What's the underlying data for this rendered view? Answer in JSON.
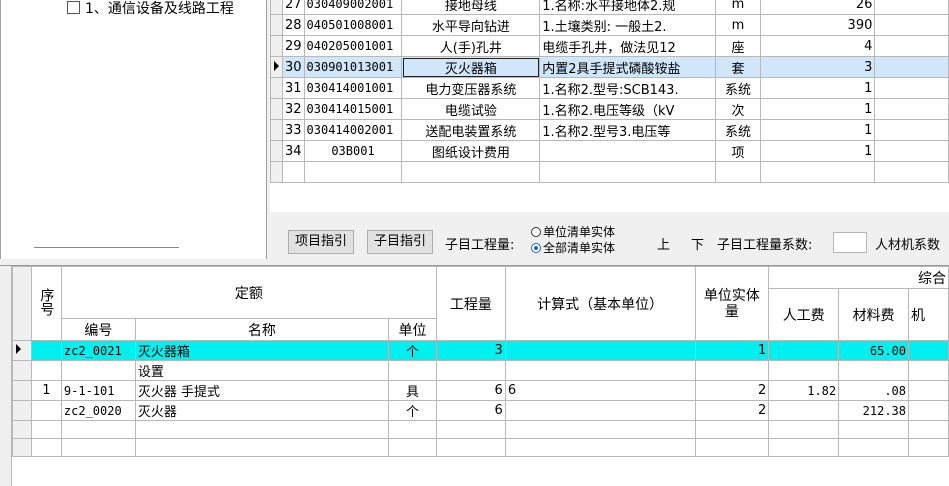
{
  "tree": {
    "item_label": "1、通信设备及线路工程"
  },
  "upper_grid": {
    "rows": [
      {
        "no": "27",
        "code": "030409002001",
        "name": "接地母线",
        "desc": "1.名称:水平接地体2.规",
        "unit": "m",
        "qty": "26"
      },
      {
        "no": "28",
        "code": "040501008001",
        "name": "水平导向钻进",
        "desc": "1.土壤类别: 一般土2.",
        "unit": "m",
        "qty": "390"
      },
      {
        "no": "29",
        "code": "040205001001",
        "name": "人(手)孔井",
        "desc": "电缆手孔井，做法见12",
        "unit": "座",
        "qty": "4"
      },
      {
        "no": "30",
        "code": "030901013001",
        "name": "灭火器箱",
        "desc": "内置2具手提式磷酸铵盐",
        "unit": "套",
        "qty": "3"
      },
      {
        "no": "31",
        "code": "030414001001",
        "name": "电力变压器系统",
        "desc": "1.名称2.型号:SCB143.",
        "unit": "系统",
        "qty": "1"
      },
      {
        "no": "32",
        "code": "030414015001",
        "name": "电缆试验",
        "desc": "1.名称2.电压等级（kV",
        "unit": "次",
        "qty": "1"
      },
      {
        "no": "33",
        "code": "030414002001",
        "name": "送配电装置系统",
        "desc": "1.名称2.型号3.电压等",
        "unit": "系统",
        "qty": "1"
      },
      {
        "no": "34",
        "code": "03B001",
        "name": "图纸设计费用",
        "desc": "",
        "unit": "项",
        "qty": "1"
      }
    ]
  },
  "toolbar": {
    "btn_item_guide": "项目指引",
    "btn_sub_guide": "子目指引",
    "sub_qty_label": "子目工程量:",
    "radio_unit_entity": "单位清单实体",
    "radio_all_entity": "全部清单实体",
    "up_label": "上",
    "down_label": "下",
    "coef_label": "子目工程量系数:",
    "labor_coef_label": "人材机系数"
  },
  "lower_grid": {
    "headers": {
      "seq": "序号",
      "quota": "定额",
      "code": "编号",
      "name": "名称",
      "unit": "单位",
      "qty": "工程量",
      "formula": "计算式（基本单位）",
      "unit_entity_qty": "单位实体量",
      "composite": "综合",
      "labor": "人工费",
      "material": "材料费",
      "machine": "机"
    },
    "rows": [
      {
        "seq": "",
        "code": "zc2_0021",
        "name": "灭火器箱",
        "unit": "个",
        "qty": "3",
        "formula": "",
        "uqty": "1",
        "labor": "",
        "material": "65.00"
      },
      {
        "seq": "",
        "code": "",
        "name": "设置",
        "unit": "",
        "qty": "",
        "formula": "",
        "uqty": "",
        "labor": "",
        "material": ""
      },
      {
        "seq": "1",
        "code": "9-1-101",
        "name": "灭火器 手提式",
        "unit": "具",
        "qty": "6",
        "formula": "6",
        "uqty": "2",
        "labor": "1.82",
        "material": ".08"
      },
      {
        "seq": "",
        "code": "zc2_0020",
        "name": "灭火器",
        "unit": "个",
        "qty": "6",
        "formula": "",
        "uqty": "2",
        "labor": "",
        "material": "212.38"
      }
    ]
  },
  "colors": {
    "selected_row": "#cfe6fb",
    "highlight_row": "#00f0f0",
    "radio_accent": "#1a63c7"
  }
}
